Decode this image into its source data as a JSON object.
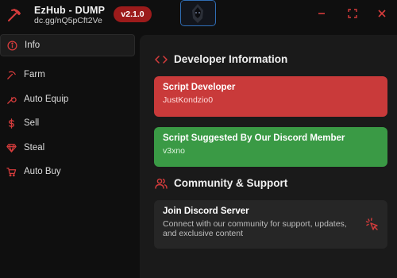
{
  "app": {
    "title": "EzHub - DUMP",
    "subtitle": "dc.gg/nQ5pCft2Ve",
    "version": "v2.1.0",
    "accent": "#d63c3c"
  },
  "window_controls": [
    "minimize-icon",
    "maximize-icon",
    "close-icon"
  ],
  "sidebar": {
    "items": [
      {
        "label": "Info",
        "icon": "info-icon",
        "active": true
      },
      {
        "label": "Farm",
        "icon": "pickaxe-icon"
      },
      {
        "label": "Auto Equip",
        "icon": "wrench-icon"
      },
      {
        "label": "Sell",
        "icon": "dollar-icon"
      },
      {
        "label": "Steal",
        "icon": "gem-icon"
      },
      {
        "label": "Auto Buy",
        "icon": "cart-icon"
      }
    ]
  },
  "main": {
    "developer_section": {
      "title": "Developer Information",
      "icon": "code-icon",
      "cards": [
        {
          "title": "Script Developer",
          "value": "JustKondzio0",
          "color": "#c93a3a"
        },
        {
          "title": "Script Suggested By Our Discord Member",
          "value": "v3xno",
          "color": "#3a9a45"
        }
      ]
    },
    "community_section": {
      "title": "Community & Support",
      "icon": "users-icon",
      "discord_card": {
        "title": "Join Discord Server",
        "description": "Connect with our community for support, updates, and exclusive content",
        "icon": "cursor-click-icon"
      }
    }
  }
}
